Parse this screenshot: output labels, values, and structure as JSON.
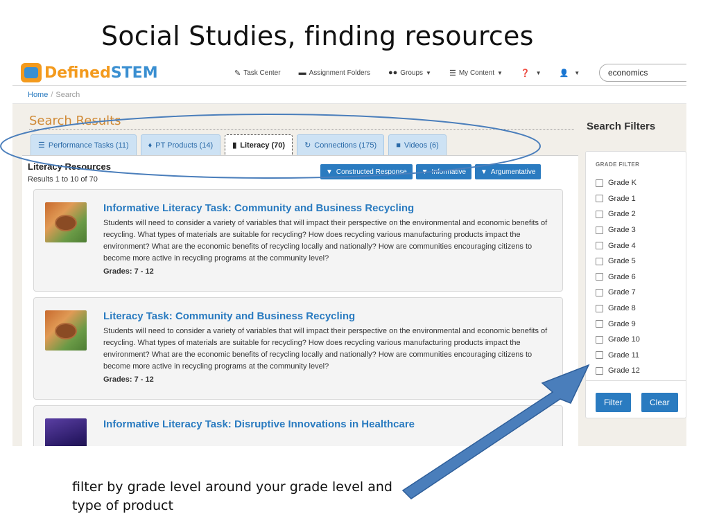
{
  "slide": {
    "title": "Social Studies, finding resources",
    "caption": "filter by grade level around your grade level and type of product"
  },
  "colors": {
    "brand_orange": "#f39a1d",
    "brand_blue": "#3a8fd1",
    "link_blue": "#2a7bc0",
    "annotation_blue": "#4a7ebb"
  },
  "header": {
    "logo_defined": "Defined",
    "logo_stem": "STEM",
    "nav": [
      {
        "label": "Task Center",
        "icon": "edit-icon"
      },
      {
        "label": "Assignment Folders",
        "icon": "folder-icon"
      },
      {
        "label": "Groups",
        "icon": "users-icon"
      },
      {
        "label": "My Content",
        "icon": "list-icon"
      },
      {
        "label": "",
        "icon": "help-icon"
      },
      {
        "label": "",
        "icon": "user-icon"
      }
    ],
    "search_value": "economics"
  },
  "breadcrumb": {
    "home": "Home",
    "separator": "/",
    "current": "Search"
  },
  "results": {
    "title": "Search Results",
    "tabs": [
      {
        "label": "Performance Tasks (11)",
        "icon": "list-icon"
      },
      {
        "label": "PT Products (14)",
        "icon": "drop-icon"
      },
      {
        "label": "Literacy (70)",
        "icon": "book-icon"
      },
      {
        "label": "Connections (175)",
        "icon": "refresh-icon"
      },
      {
        "label": "Videos (6)",
        "icon": "video-camera-icon"
      }
    ],
    "heading": "Literacy Resources",
    "count": "Results 1 to 10 of 70",
    "filter_buttons": [
      "Constructed Response",
      "Informative",
      "Argumentative"
    ],
    "cards": [
      {
        "title": "Informative Literacy Task: Community and Business Recycling",
        "description": "Students will need to consider a variety of variables that will impact their perspective on the environmental and economic benefits of recycling. What types of materials are suitable for recycling? How does recycling various manufacturing products impact the environment? What are the economic benefits of recycling locally and nationally? How are communities encouraging citizens to become more active in recycling programs at the community level?",
        "grades": "Grades: 7 - 12"
      },
      {
        "title": "Literacy Task: Community and Business Recycling",
        "description": "Students will need to consider a variety of variables that will impact their perspective on the environmental and economic benefits of recycling. What types of materials are suitable for recycling? How does recycling various manufacturing products impact the environment? What are the economic benefits of recycling locally and nationally? How are communities encouraging citizens to become more active in recycling programs at the community level?",
        "grades": "Grades: 7 - 12"
      },
      {
        "title": "Informative Literacy Task: Disruptive Innovations in Healthcare",
        "description": "",
        "grades": ""
      }
    ]
  },
  "filters": {
    "title": "Search Filters",
    "section_label": "GRADE FILTER",
    "grades": [
      "Grade K",
      "Grade 1",
      "Grade 2",
      "Grade 3",
      "Grade 4",
      "Grade 5",
      "Grade 6",
      "Grade 7",
      "Grade 8",
      "Grade 9",
      "Grade 10",
      "Grade 11",
      "Grade 12"
    ],
    "filter_label": "Filter",
    "clear_label": "Clear"
  }
}
